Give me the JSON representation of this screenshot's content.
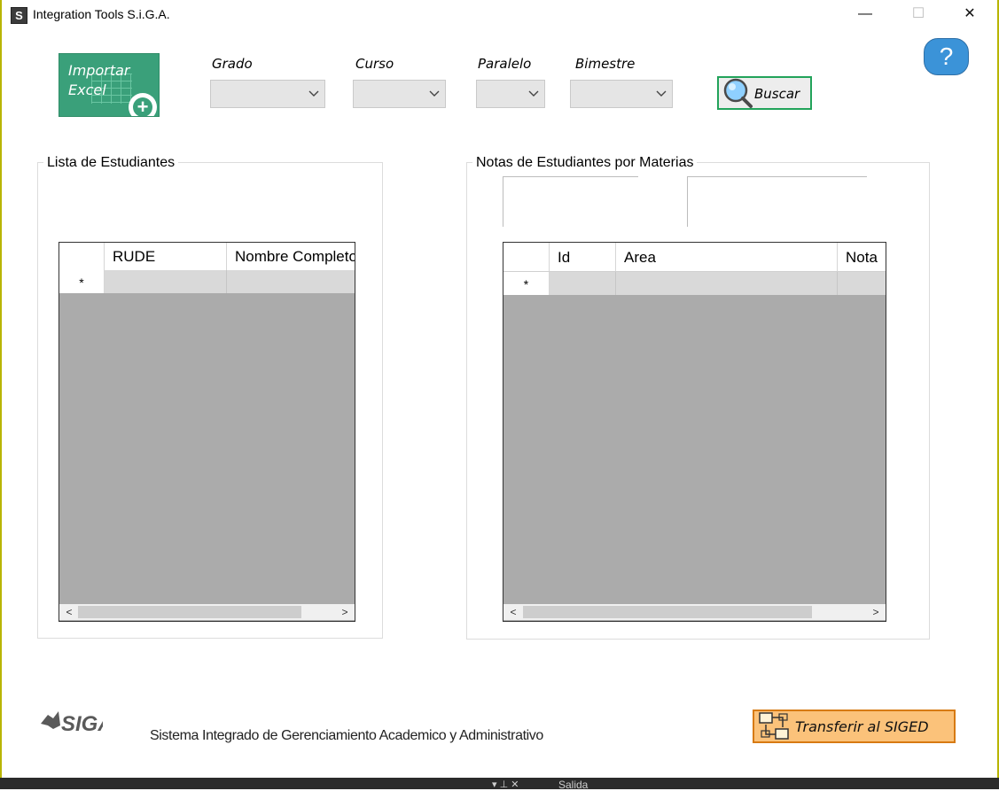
{
  "window": {
    "app_icon_letter": "S",
    "title": "Integration Tools S.i.G.A.",
    "minimize_glyph": "—",
    "maximize_glyph": "☐",
    "close_glyph": "✕"
  },
  "toolbar": {
    "import_line1": "Importar",
    "import_line2": "Excel",
    "grado_label": "Grado",
    "curso_label": "Curso",
    "paralelo_label": "Paralelo",
    "bimestre_label": "Bimestre",
    "buscar_label": "Buscar",
    "help_glyph": "?"
  },
  "estudiantes": {
    "group_title": "Lista de Estudiantes",
    "columns": [
      "RUDE",
      "Nombre Completo"
    ],
    "new_row_marker": "*"
  },
  "notas": {
    "group_title": "Notas de Estudiantes por Materias",
    "columns": [
      "Id",
      "Area",
      "Nota"
    ],
    "new_row_marker": "*"
  },
  "footer": {
    "logo_text": "SIGA",
    "description": "Sistema Integrado de Gerenciamiento Academico y Administrativo",
    "transfer_label": "Transferir al SIGED"
  },
  "taskbar": {
    "salida_label": "Salida"
  },
  "icons": {
    "search": "magnifier-icon",
    "help": "question-icon",
    "transfer": "network-transfer-icon"
  },
  "colors": {
    "import_green": "#3aa07a",
    "buscar_border": "#22a35a",
    "transfer_fill": "#fbc27a",
    "transfer_border": "#d77a12",
    "help_blue": "#3b93d8",
    "grid_gray": "#ababab"
  }
}
